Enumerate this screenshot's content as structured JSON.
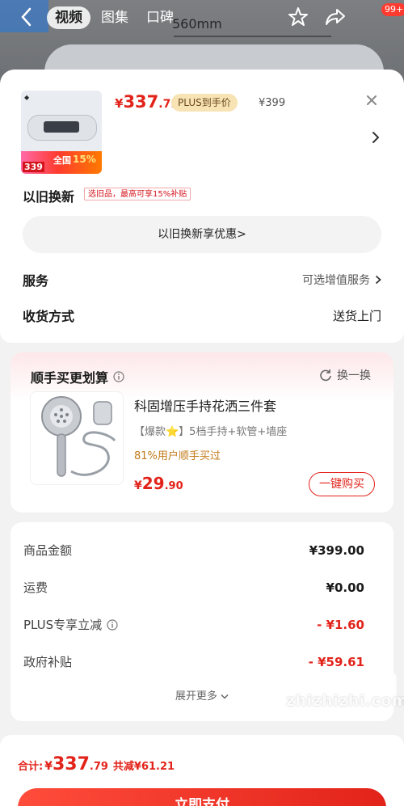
{
  "topnav": {
    "tabs": [
      "视频",
      "图集",
      "口碑"
    ],
    "badge": "99+",
    "background_label": "560mm"
  },
  "header": {
    "price": {
      "yen": "¥",
      "main": "337",
      "dec": ".79"
    },
    "plus_tag": "PLUS到手价",
    "orig_price": "¥399",
    "thumb": {
      "price": "339",
      "quan": "全国",
      "pct": "15%"
    }
  },
  "tradein": {
    "label": "以旧换新",
    "tag": "选旧品，最高可享15%补贴",
    "button": "以旧换新享优惠>"
  },
  "service": {
    "label": "服务",
    "value": "可选增值服务"
  },
  "delivery": {
    "label": "收货方式",
    "value": "送货上门"
  },
  "bundle": {
    "title": "顺手买更划算",
    "refresh": "换一换",
    "name": "科固增压手持花洒三件套",
    "desc": "【爆款⭐】5档手持+软管+墙座",
    "bought": "81%用户顺手买过",
    "price": {
      "yen": "¥",
      "main": "29",
      "dec": ".90"
    },
    "buy": "一键购买"
  },
  "summary": {
    "rows": [
      {
        "label": "商品金额",
        "value": "¥399.00"
      },
      {
        "label": "运费",
        "value": "¥0.00"
      },
      {
        "label": "PLUS专享立减",
        "value": "- ¥1.60"
      },
      {
        "label": "政府补贴",
        "value": "- ¥59.61"
      }
    ],
    "expand": "展开更多"
  },
  "footer": {
    "total_label": "合计:",
    "yen": "¥",
    "main": "337",
    "dec": ".79",
    "save": "共减¥61.21",
    "pay": "立即支付"
  },
  "watermark": "zhizhizhi.com",
  "colors": {
    "accent": "#e2231a",
    "gold": "#c27a1a",
    "plus_bg": "#f8e3b5"
  }
}
